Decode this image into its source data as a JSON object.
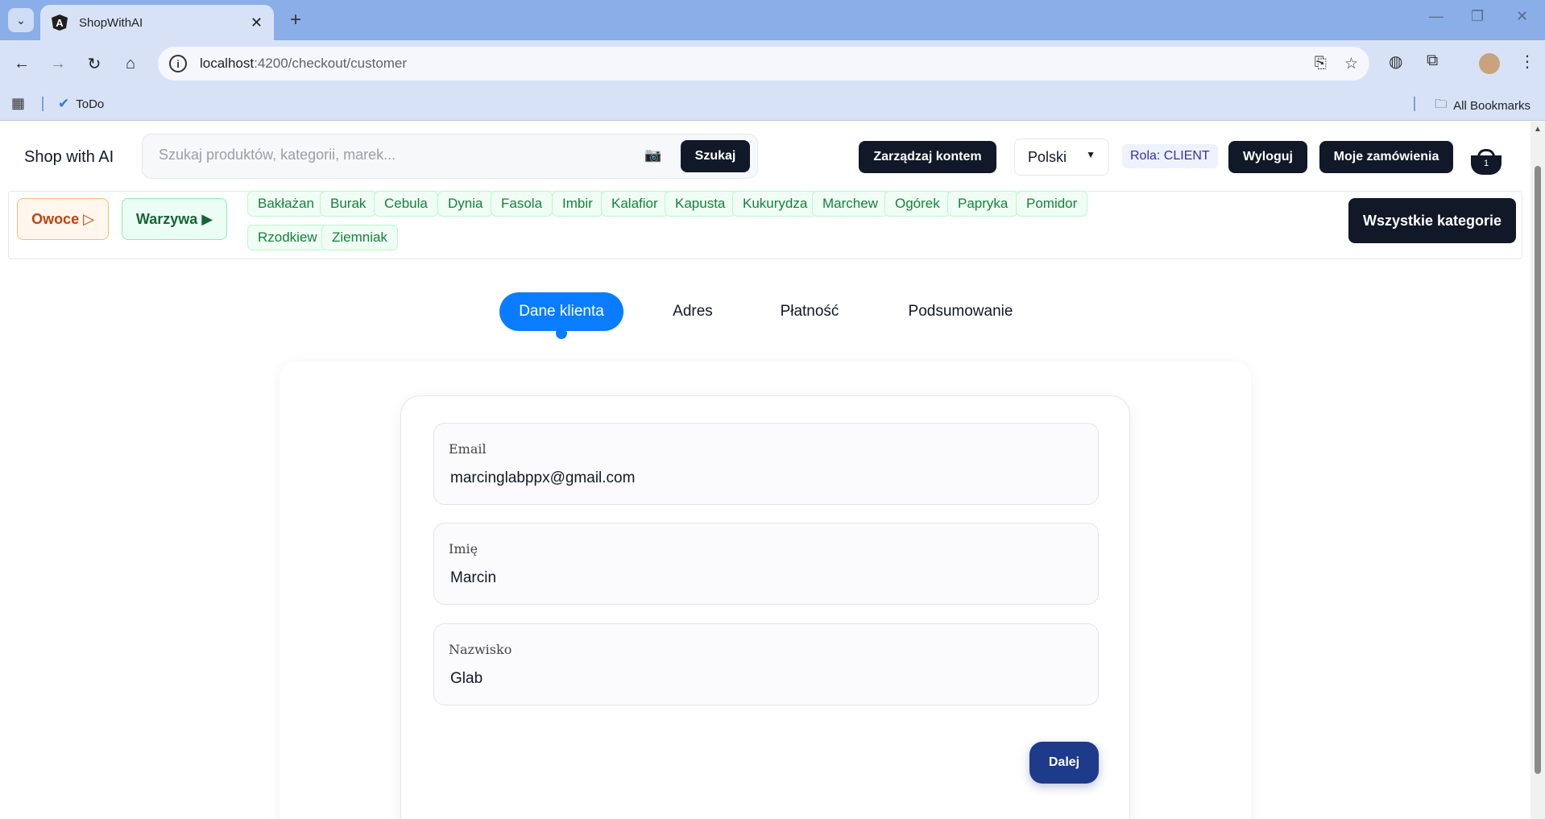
{
  "browser": {
    "tab_title": "ShopWithAI",
    "tab_logo": "A",
    "url_host": "localhost",
    "url_rest": ":4200/checkout/customer",
    "bookmark_todo": "ToDo",
    "bookmark_all": "All Bookmarks"
  },
  "header": {
    "brand": "Shop with AI",
    "search_placeholder": "Szukaj produktów, kategorii, marek...",
    "search_button": "Szukaj",
    "manage_account": "Zarządzaj kontem",
    "language": "Polski",
    "role": "Rola: CLIENT",
    "logout": "Wyloguj",
    "my_orders": "Moje zamówienia",
    "cart_count": "1"
  },
  "categories": {
    "fruit": "Owoce ▷",
    "vegetables": "Warzywa ▶",
    "subcategories": [
      "Bakłażan",
      "Burak",
      "Cebula",
      "Dynia",
      "Fasola",
      "Imbir",
      "Kalafior",
      "Kapusta",
      "Kukurydza",
      "Marchew",
      "Ogórek",
      "Papryka",
      "Pomidor",
      "Rzodkiew",
      "Ziemniak"
    ],
    "all_categories": "Wszystkie kategorie"
  },
  "steps": [
    "Dane klienta",
    "Adres",
    "Płatność",
    "Podsumowanie"
  ],
  "form": {
    "email_label": "Email",
    "email_value": "marcinglabppx@gmail.com",
    "first_name_label": "Imię",
    "first_name_value": "Marcin",
    "last_name_label": "Nazwisko",
    "last_name_value": "Glab",
    "next_button": "Dalej"
  }
}
